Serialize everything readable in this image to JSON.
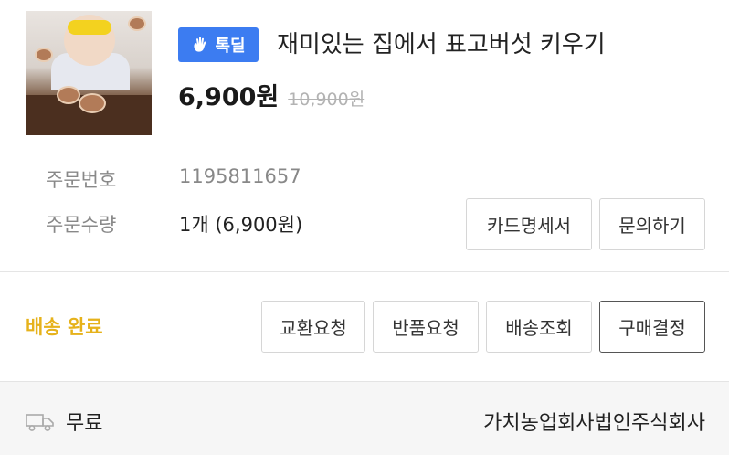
{
  "product": {
    "badge_label": "톡딜",
    "title": "재미있는 집에서 표고버섯 키우기",
    "price": "6,900원",
    "original_price": "10,900원"
  },
  "order": {
    "number_label": "주문번호",
    "number_value": "1195811657",
    "quantity_label": "주문수량",
    "quantity_value": "1개 (6,900원)"
  },
  "actions_top": {
    "receipt_label": "카드명세서",
    "inquiry_label": "문의하기"
  },
  "status": {
    "text": "배송 완료",
    "color": "#e6b21b"
  },
  "actions_bottom": {
    "exchange_label": "교환요청",
    "return_label": "반품요청",
    "tracking_label": "배송조회",
    "confirm_label": "구매결정"
  },
  "footer": {
    "shipping_fee": "무료",
    "seller": "가치농업회사법인주식회사"
  },
  "colors": {
    "badge_bg": "#3c7cf1",
    "status": "#e6b21b"
  },
  "icons": {
    "badge_icon": "waving-hand-icon",
    "shipping_icon": "truck-icon"
  }
}
